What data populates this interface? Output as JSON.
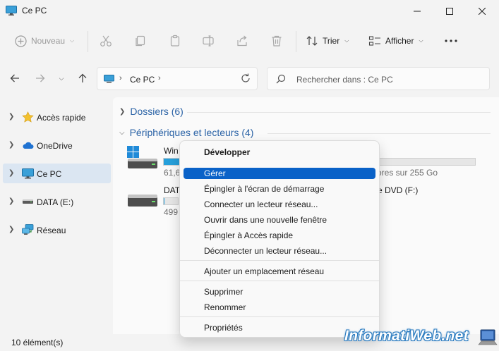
{
  "window": {
    "title": "Ce PC"
  },
  "toolbar": {
    "new_label": "Nouveau",
    "sort_label": "Trier",
    "view_label": "Afficher"
  },
  "nav": {
    "breadcrumb": "Ce PC",
    "search_placeholder": "Rechercher dans : Ce PC"
  },
  "sidebar": {
    "items": [
      {
        "label": "Accès rapide",
        "icon": "star-icon"
      },
      {
        "label": "OneDrive",
        "icon": "cloud-icon"
      },
      {
        "label": "Ce PC",
        "icon": "computer-icon",
        "selected": true
      },
      {
        "label": "DATA (E:)",
        "icon": "drive-icon"
      },
      {
        "label": "Réseau",
        "icon": "network-icon"
      }
    ]
  },
  "content": {
    "groups": [
      {
        "label": "Dossiers (6)"
      },
      {
        "label": "Périphériques et lecteurs (4)"
      }
    ],
    "drives": [
      {
        "name": "Win",
        "size": "61,6",
        "size_right": "ores sur 255 Go",
        "used_fraction": 0.24
      },
      {
        "name": "DAT",
        "size": "499",
        "used_fraction": 0.01
      }
    ],
    "dvd_label": "e DVD (F:)"
  },
  "context_menu": {
    "items": [
      {
        "label": "Développer",
        "bold": true
      },
      {
        "label": "Gérer",
        "highlighted": true
      },
      {
        "label": "Épingler à l'écran de démarrage"
      },
      {
        "label": "Connecter un lecteur réseau..."
      },
      {
        "label": "Ouvrir dans une nouvelle fenêtre"
      },
      {
        "label": "Épingler à Accès rapide"
      },
      {
        "label": "Déconnecter un lecteur réseau..."
      },
      {
        "label": "Ajouter un emplacement réseau"
      },
      {
        "label": "Supprimer"
      },
      {
        "label": "Renommer"
      },
      {
        "label": "Propriétés"
      }
    ]
  },
  "status": {
    "text": "10 élément(s)"
  },
  "watermark": {
    "text": "InformatiWeb.net"
  },
  "colors": {
    "accent": "#0a62c8",
    "progress": "#27a0db",
    "group_header": "#2b63a6"
  }
}
